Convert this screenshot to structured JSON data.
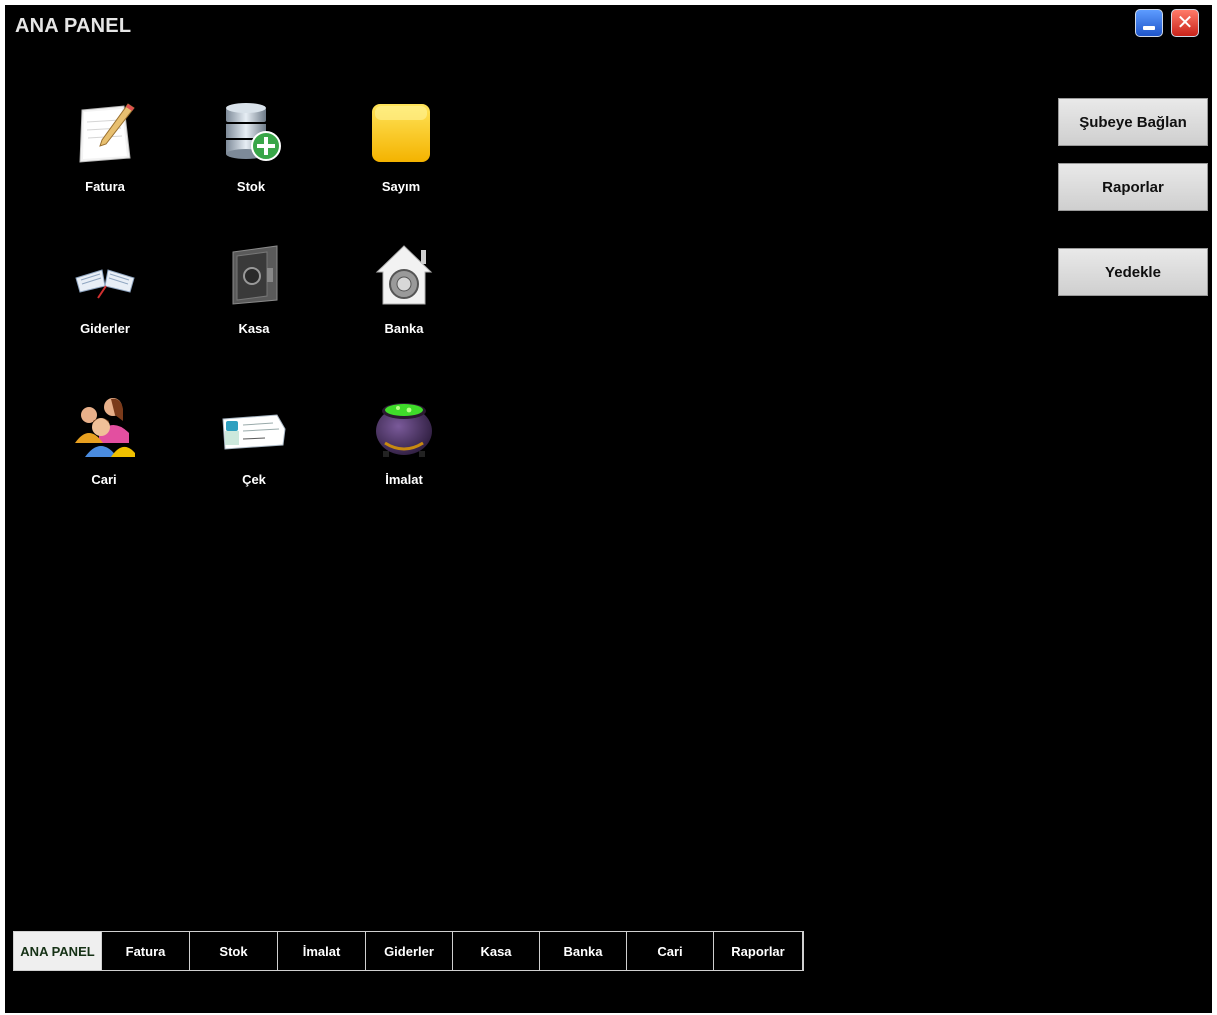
{
  "window": {
    "title": "ANA PANEL"
  },
  "tiles": [
    {
      "label": "Fatura",
      "icon": "invoice-notepad-icon"
    },
    {
      "label": "Stok",
      "icon": "database-add-icon"
    },
    {
      "label": "Sayım",
      "icon": "yellow-square-icon"
    },
    {
      "label": "Giderler",
      "icon": "open-book-icon"
    },
    {
      "label": "Kasa",
      "icon": "safe-icon"
    },
    {
      "label": "Banka",
      "icon": "vault-house-icon"
    },
    {
      "label": "Cari",
      "icon": "people-group-icon"
    },
    {
      "label": "Çek",
      "icon": "cheque-icon"
    },
    {
      "label": "İmalat",
      "icon": "cauldron-icon"
    }
  ],
  "side_buttons": {
    "connect": "Şubeye Bağlan",
    "reports": "Raporlar",
    "backup": "Yedekle"
  },
  "tabs": [
    {
      "label": "ANA PANEL",
      "active": true
    },
    {
      "label": "Fatura"
    },
    {
      "label": "Stok"
    },
    {
      "label": "İmalat"
    },
    {
      "label": "Giderler"
    },
    {
      "label": "Kasa"
    },
    {
      "label": "Banka"
    },
    {
      "label": "Cari"
    },
    {
      "label": "Raporlar"
    }
  ],
  "colors": {
    "background": "#000000",
    "minimize": "#2f6fe0",
    "close": "#e0392b",
    "active_tab": "#efefef"
  }
}
